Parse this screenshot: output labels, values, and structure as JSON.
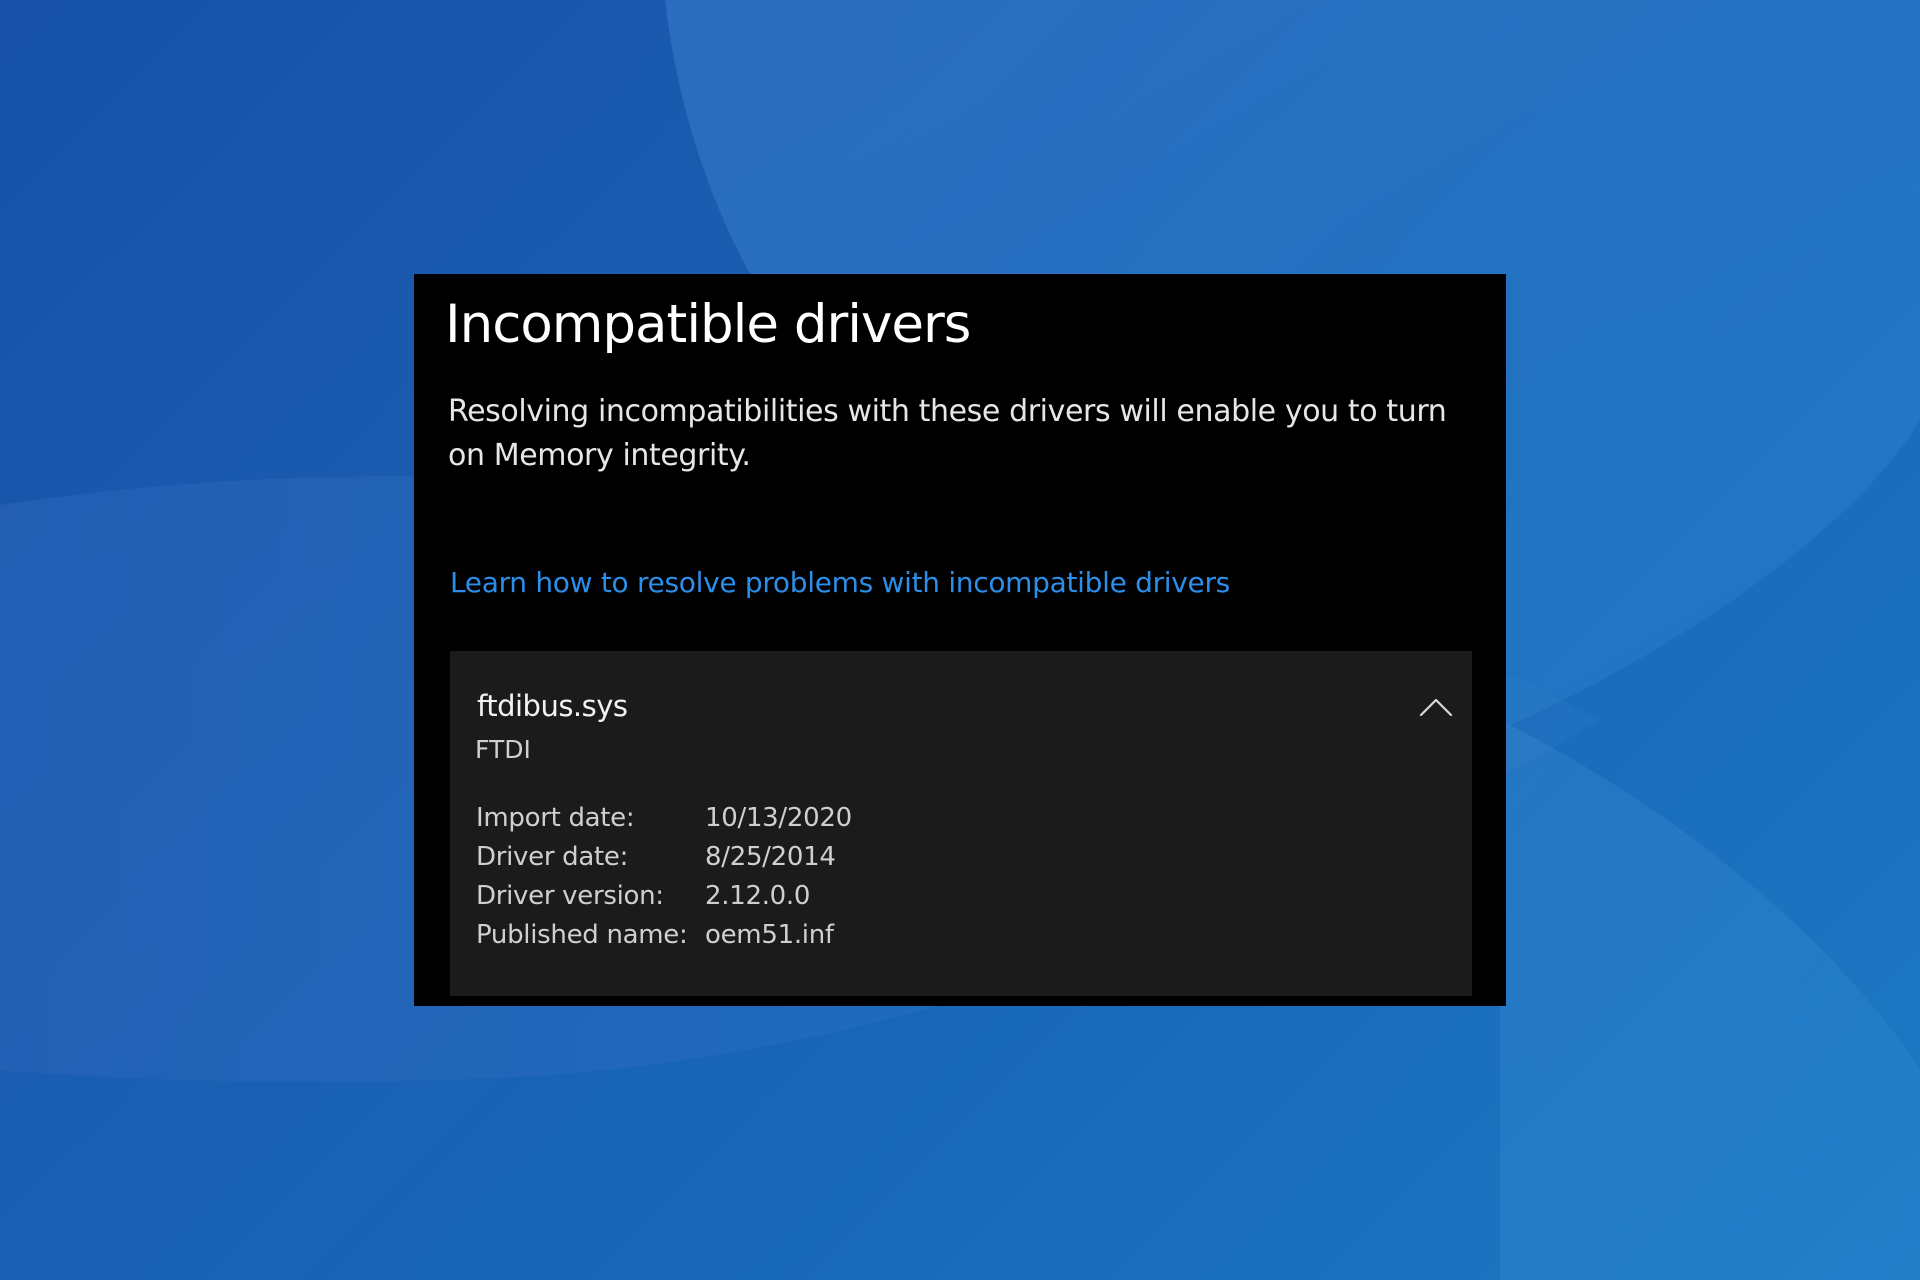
{
  "window": {
    "title": "Incompatible drivers",
    "description": "Resolving incompatibilities with these drivers will enable you to turn on Memory integrity.",
    "learn_link": "Learn how to resolve problems with incompatible drivers"
  },
  "driver": {
    "name": "ftdibus.sys",
    "vendor": "FTDI",
    "expanded": true,
    "details": [
      {
        "label": "Import date:",
        "value": "10/13/2020"
      },
      {
        "label": "Driver date:",
        "value": "8/25/2014"
      },
      {
        "label": "Driver version:",
        "value": "2.12.0.0"
      },
      {
        "label": "Published name:",
        "value": "oem51.inf"
      }
    ]
  },
  "colors": {
    "panel_background": "#000000",
    "card_background": "#1b1b1b",
    "link": "#2b8ee8",
    "wallpaper": "#1a5cb0"
  },
  "icons": {
    "collapse": "chevron-up-icon"
  }
}
